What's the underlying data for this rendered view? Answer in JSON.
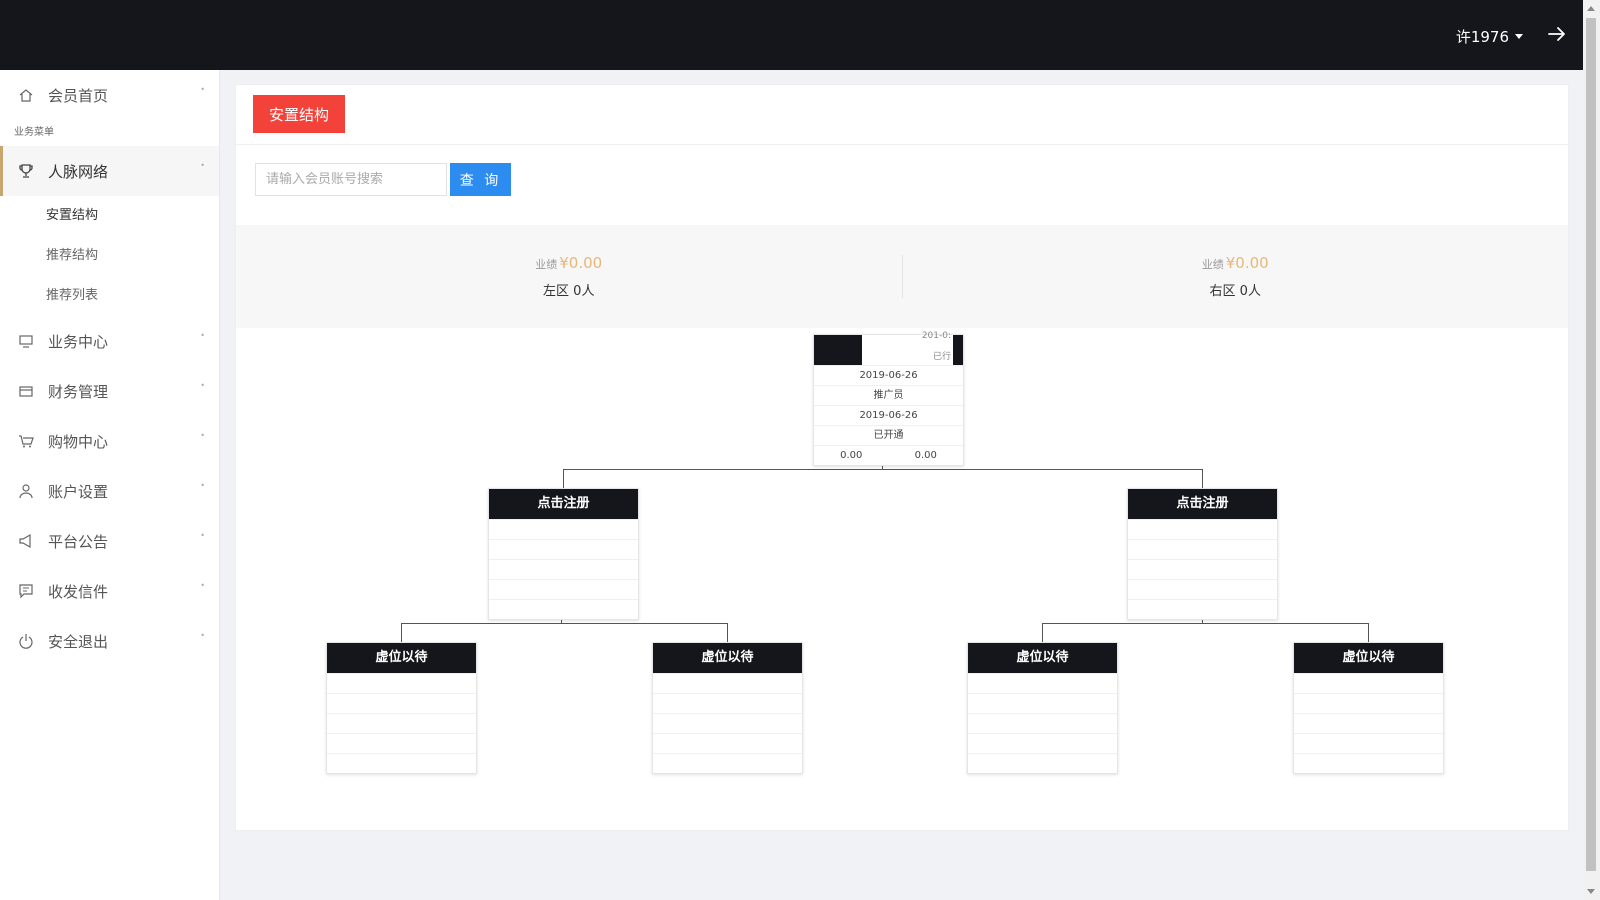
{
  "header": {
    "username": "许1976"
  },
  "sidebar": {
    "home": "会员首页",
    "section_label": "业务菜单",
    "network": {
      "label": "人脉网络",
      "subitems": [
        "安置结构",
        "推荐结构",
        "推荐列表"
      ]
    },
    "items": [
      "业务中心",
      "财务管理",
      "购物中心",
      "账户设置",
      "平台公告",
      "收发信件",
      "安全退出"
    ]
  },
  "main": {
    "tab_label": "安置结构",
    "search": {
      "placeholder": "请输入会员账号搜索",
      "button": "查 询"
    },
    "stats": {
      "left": {
        "perf_label": "业绩",
        "amount": "¥0.00",
        "count": "左区 0人"
      },
      "right": {
        "perf_label": "业绩",
        "amount": "¥0.00",
        "count": "右区 0人"
      }
    },
    "tree": {
      "root": {
        "head_text_1": "201-0:",
        "head_text_2": "已行",
        "rows": [
          "2019-06-26",
          "推广员",
          "2019-06-26",
          "已开通"
        ],
        "left_value": "0.00",
        "right_value": "0.00"
      },
      "level2_label": "点击注册",
      "level3_label": "虚位以待"
    }
  }
}
